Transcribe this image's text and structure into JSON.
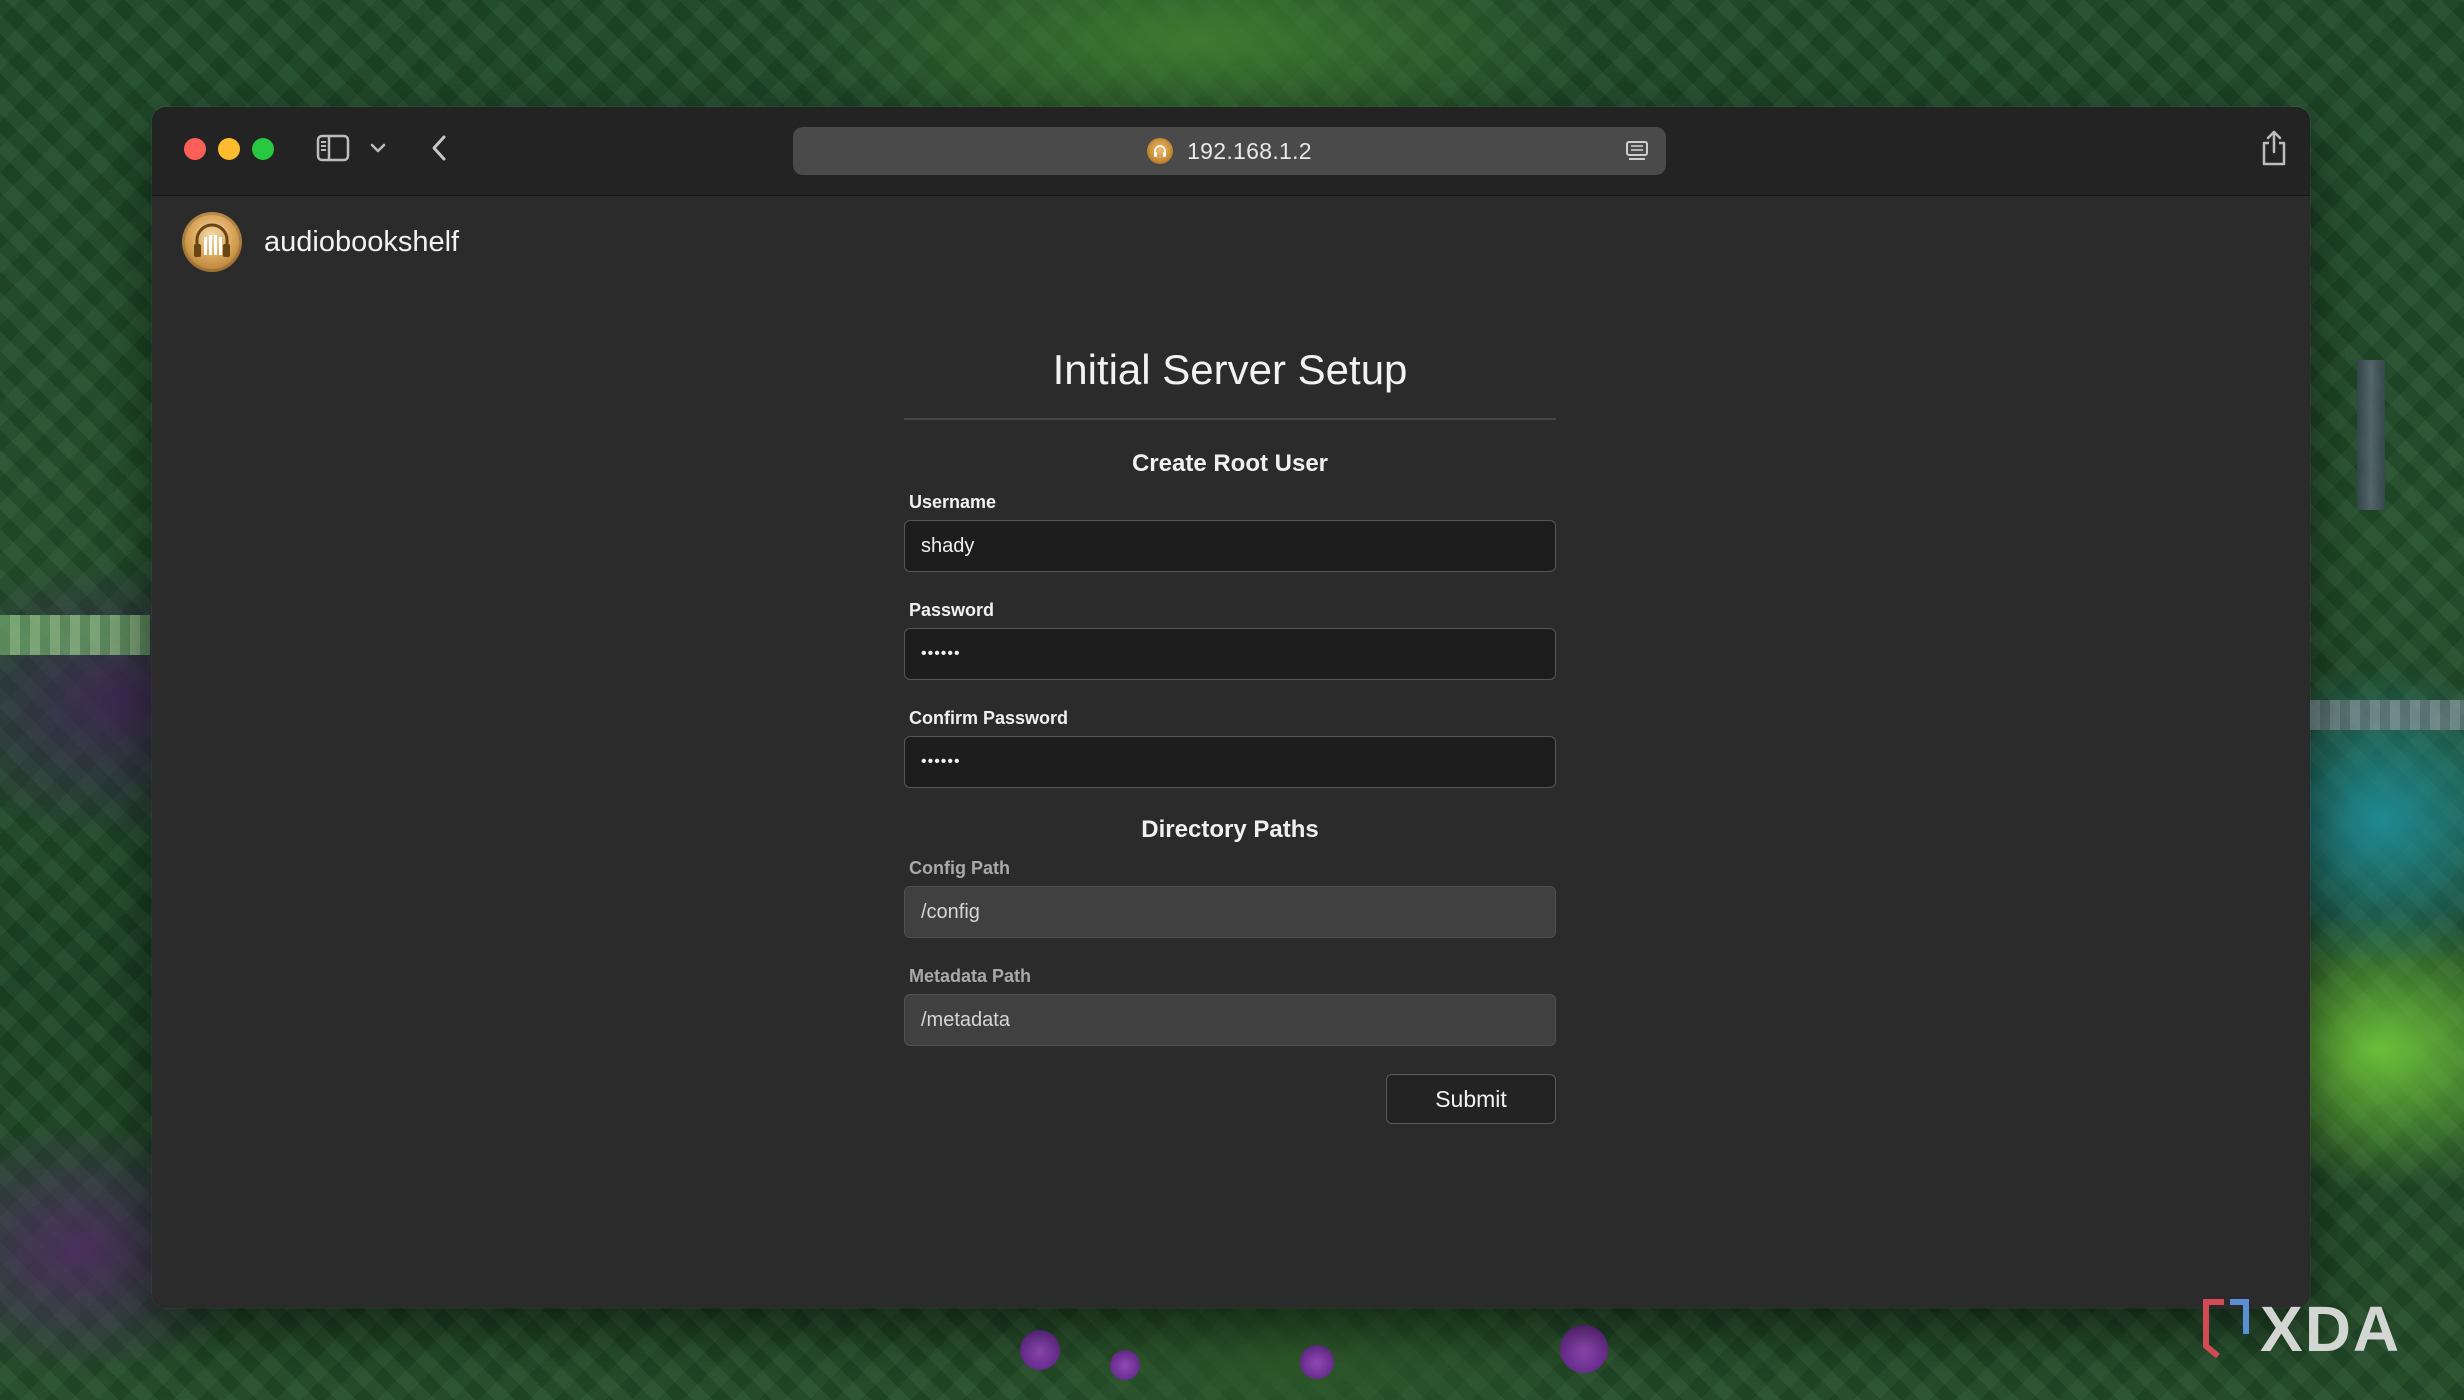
{
  "browser": {
    "address": "192.168.1.2"
  },
  "app": {
    "name": "audiobookshelf"
  },
  "setup": {
    "title": "Initial Server Setup",
    "root_section_title": "Create Root User",
    "username_label": "Username",
    "username_value": "shady",
    "password_label": "Password",
    "password_value": "••••••",
    "confirm_label": "Confirm Password",
    "confirm_value": "••••••",
    "paths_section_title": "Directory Paths",
    "config_label": "Config Path",
    "config_value": "/config",
    "metadata_label": "Metadata Path",
    "metadata_value": "/metadata",
    "submit_label": "Submit"
  },
  "watermark": {
    "text": "XDA"
  },
  "colors": {
    "window_bg": "#2b2b2b",
    "titlebar_bg": "#232323",
    "close": "#ff5f57",
    "minimize": "#febc2e",
    "zoom": "#28c840",
    "input_bg": "#1d1d1d",
    "disabled_input_bg": "#404040"
  },
  "icons": {
    "sidebar": "sidebar-icon",
    "chevron": "chevron-down-icon",
    "back": "chevron-left-icon",
    "reader": "reader-icon",
    "share": "share-icon",
    "new_tab": "plus-icon",
    "tabs": "tabs-overview-icon",
    "logo": "headphones-books-icon"
  }
}
